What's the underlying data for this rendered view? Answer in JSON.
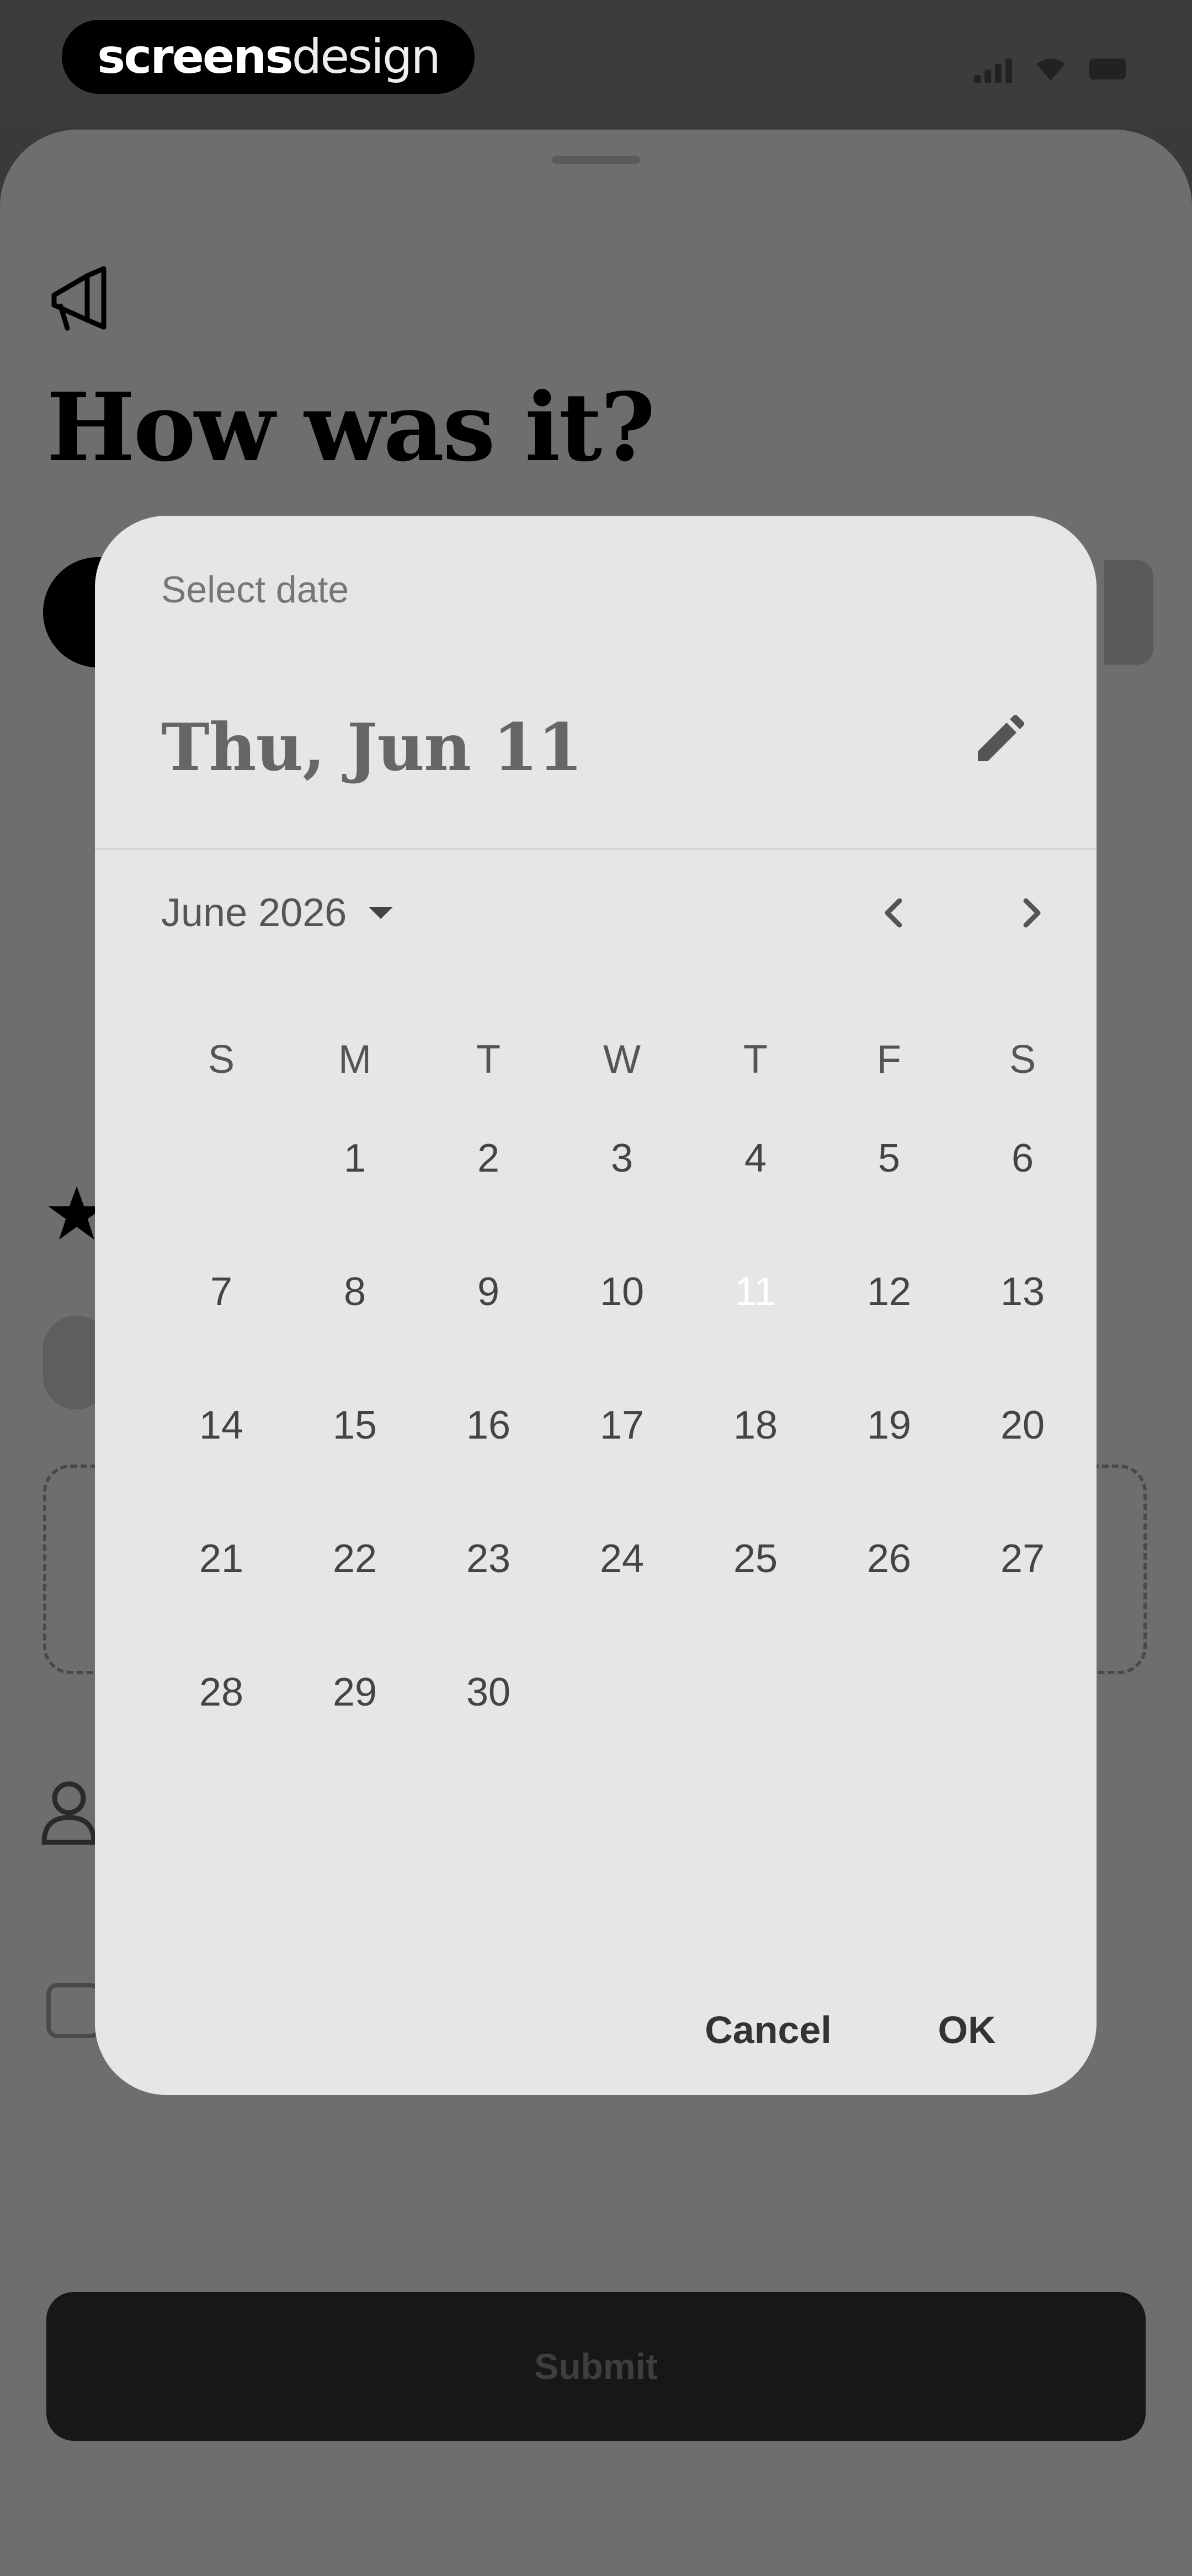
{
  "status_bar": {
    "brand_bold": "screens",
    "brand_light": "design"
  },
  "background": {
    "title": "How was it?",
    "submit_label": "Submit"
  },
  "date_picker": {
    "header_label": "Select date",
    "selected_date": "Thu, Jun 11",
    "month_label": "June 2026",
    "weekdays": [
      "S",
      "M",
      "T",
      "W",
      "T",
      "F",
      "S"
    ],
    "days": [
      "1",
      "2",
      "3",
      "4",
      "5",
      "6",
      "7",
      "8",
      "9",
      "10",
      "11",
      "12",
      "13",
      "14",
      "15",
      "16",
      "17",
      "18",
      "19",
      "20",
      "21",
      "22",
      "23",
      "24",
      "25",
      "26",
      "27",
      "28",
      "29",
      "30"
    ],
    "first_weekday_index": 1,
    "selected_day": "11",
    "cancel_label": "Cancel",
    "ok_label": "OK"
  },
  "icons": {
    "megaphone": "megaphone-icon",
    "edit": "pencil-icon",
    "prev": "chevron-left-icon",
    "next": "chevron-right-icon",
    "dropdown": "caret-down-icon"
  },
  "colors": {
    "selected_day_fill": "#000000",
    "dialog_bg": "#e6e6e6",
    "scrim": "#6e6e6e"
  }
}
